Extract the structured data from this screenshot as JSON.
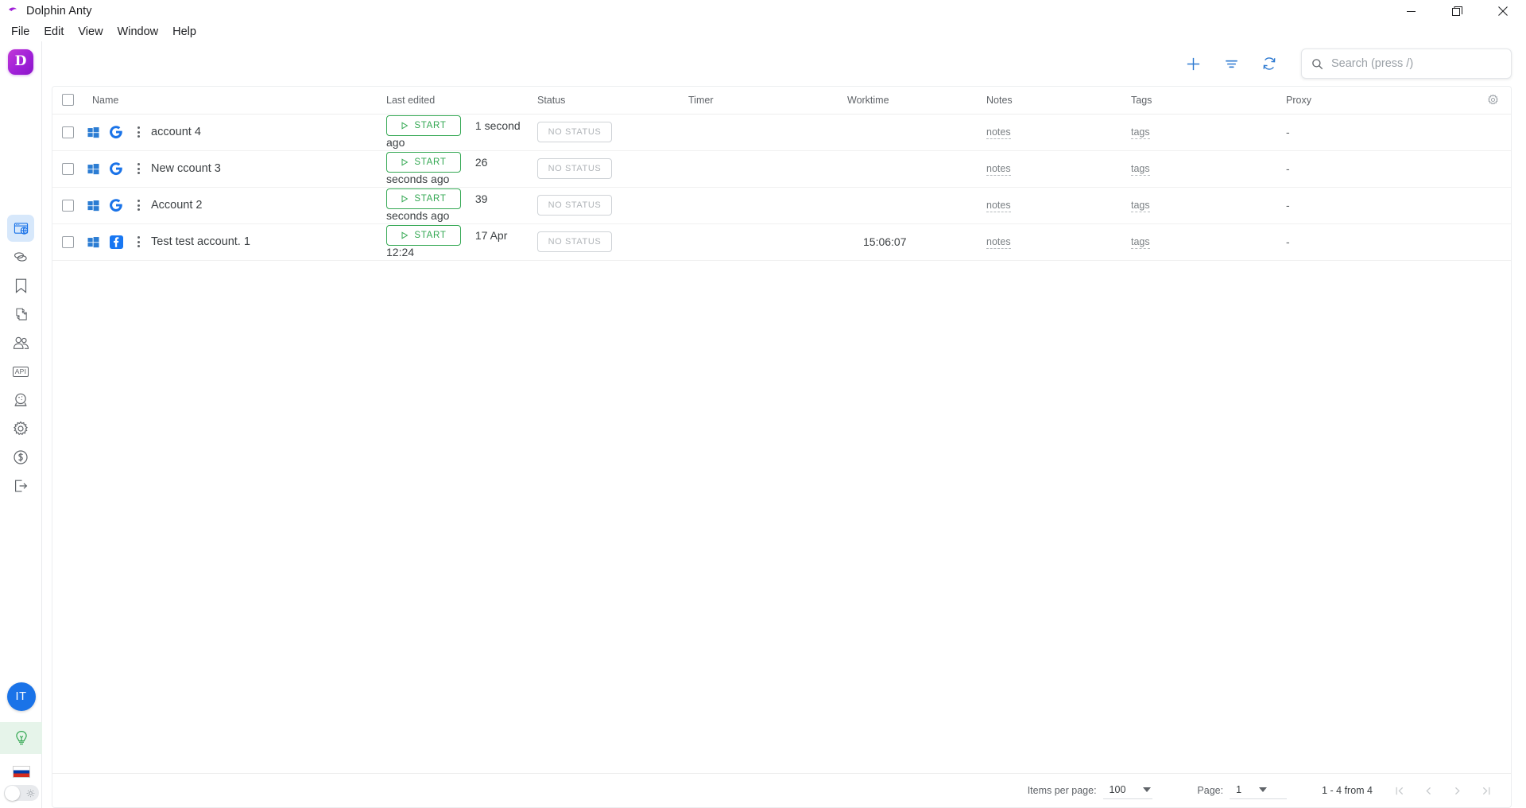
{
  "window": {
    "title": "Dolphin Anty",
    "app_icon": "dolphin-logo-icon",
    "controls": {
      "minimize": "minimize-icon",
      "maximize": "maximize-icon",
      "close": "close-icon"
    }
  },
  "menubar": {
    "items": [
      {
        "label": "File"
      },
      {
        "label": "Edit"
      },
      {
        "label": "View"
      },
      {
        "label": "Window"
      },
      {
        "label": "Help"
      }
    ]
  },
  "sidebar": {
    "logo_letter": "D",
    "items": [
      {
        "name": "browser-profiles",
        "icon": "browser-globe-icon",
        "active": true
      },
      {
        "name": "proxies",
        "icon": "chain-links-icon",
        "active": false
      },
      {
        "name": "bookmarks",
        "icon": "bookmark-icon",
        "active": false
      },
      {
        "name": "extensions",
        "icon": "puzzle-icon",
        "active": false
      },
      {
        "name": "team",
        "icon": "users-icon",
        "active": false
      },
      {
        "name": "api",
        "icon": "api-icon",
        "label": "API",
        "active": false
      },
      {
        "name": "automation",
        "icon": "crystal-ball-icon",
        "active": false
      },
      {
        "name": "settings",
        "icon": "gear-icon",
        "active": false
      },
      {
        "name": "pricing",
        "icon": "dollar-circle-icon",
        "active": false
      },
      {
        "name": "logout",
        "icon": "logout-icon",
        "active": false
      }
    ],
    "avatar_initials": "IT",
    "tips_icon": "lightbulb-icon",
    "language_flag": "russian-flag",
    "theme_toggle": {
      "state": "light",
      "icon": "sun-icon"
    }
  },
  "toolbar": {
    "add": "plus-icon",
    "filter": "filter-icon",
    "refresh": "refresh-icon",
    "search": {
      "placeholder": "Search (press /)",
      "value": "",
      "icon": "search-icon"
    }
  },
  "table": {
    "columns": [
      "Name",
      "Last edited",
      "Status",
      "Timer",
      "Worktime",
      "Notes",
      "Tags",
      "Proxy"
    ],
    "settings_icon": "gear-icon",
    "select_all_checked": false,
    "rows": [
      {
        "checked": false,
        "os": "windows-icon",
        "browser": "google-icon",
        "name": "account 4",
        "start_label": "START",
        "last_edited": "1 second ago",
        "status": "NO STATUS",
        "timer": "",
        "worktime": "",
        "notes": "notes",
        "tags": "tags",
        "proxy": "-"
      },
      {
        "checked": false,
        "os": "windows-icon",
        "browser": "google-icon",
        "name": "New ccount 3",
        "start_label": "START",
        "last_edited": "26 seconds ago",
        "status": "NO STATUS",
        "timer": "",
        "worktime": "",
        "notes": "notes",
        "tags": "tags",
        "proxy": "-"
      },
      {
        "checked": false,
        "os": "windows-icon",
        "browser": "google-icon",
        "name": "Account 2",
        "start_label": "START",
        "last_edited": "39 seconds ago",
        "status": "NO STATUS",
        "timer": "",
        "worktime": "",
        "notes": "notes",
        "tags": "tags",
        "proxy": "-"
      },
      {
        "checked": false,
        "os": "windows-icon",
        "browser": "facebook-icon",
        "name": "Test test account. 1",
        "start_label": "START",
        "last_edited": "17 Apr 12:24",
        "status": "NO STATUS",
        "timer": "",
        "worktime": "15:06:07",
        "notes": "notes",
        "tags": "tags",
        "proxy": "-"
      }
    ]
  },
  "footer": {
    "items_per_page_label": "Items per page:",
    "items_per_page_value": "100",
    "page_label": "Page:",
    "page_value": "1",
    "range": "1 - 4 from 4",
    "nav": {
      "first": "first-page-icon",
      "prev": "prev-page-icon",
      "next": "next-page-icon",
      "last": "last-page-icon"
    }
  },
  "colors": {
    "accent_blue": "#2e7ad1",
    "start_green": "#34a853",
    "brand_purple": "#a020d8",
    "active_nav_bg": "#d7e8fb"
  }
}
